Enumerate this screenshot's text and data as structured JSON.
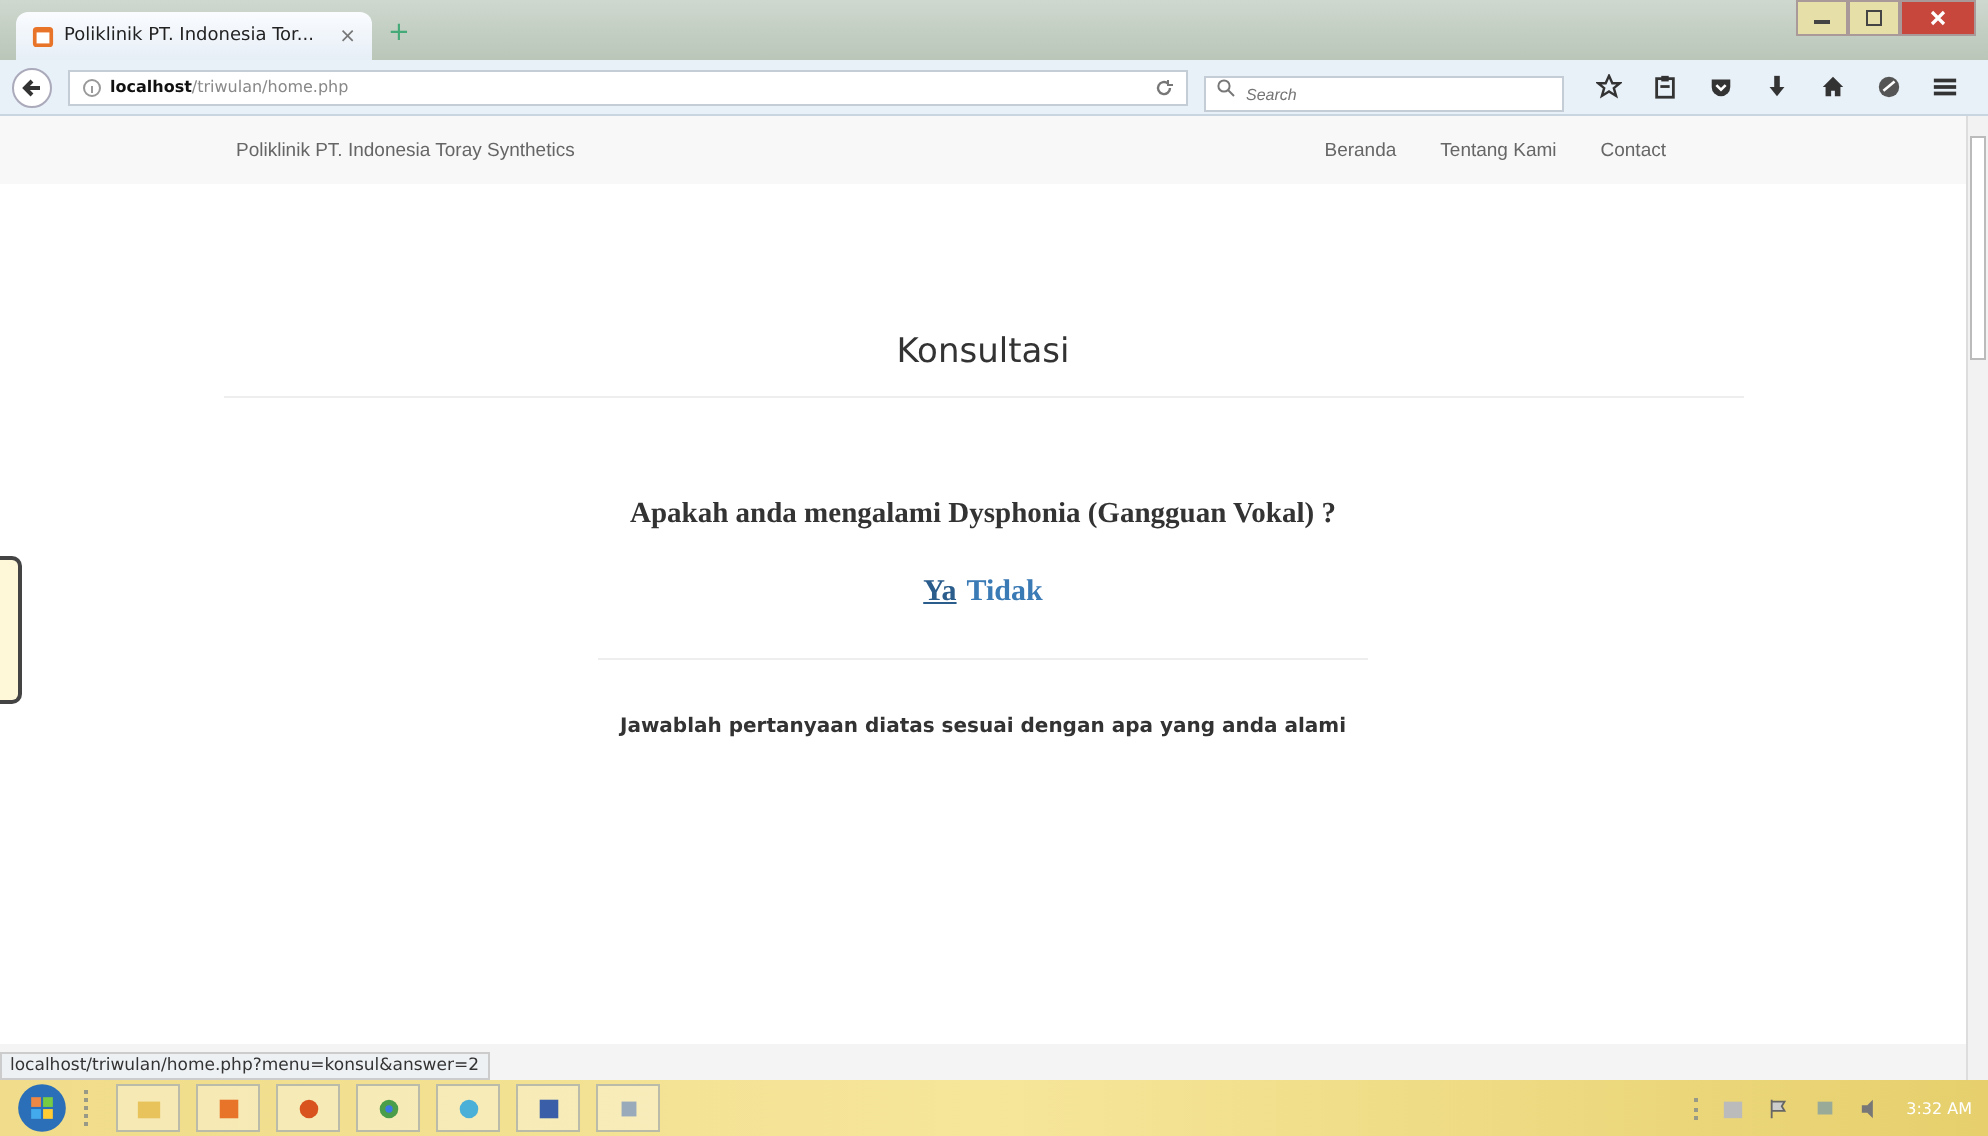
{
  "browser": {
    "tab_title": "Poliklinik PT. Indonesia Tor...",
    "tab_close": "×",
    "new_tab": "+",
    "url_host": "localhost",
    "url_path": "/triwulan/home.php",
    "search_placeholder": "Search"
  },
  "navbar": {
    "brand": "Poliklinik PT. Indonesia Toray Synthetics",
    "links": [
      {
        "label": "Beranda"
      },
      {
        "label": "Tentang Kami"
      },
      {
        "label": "Contact"
      }
    ]
  },
  "page": {
    "title": "Konsultasi",
    "question": "Apakah anda mengalami Dysphonia (Gangguan Vokal) ?",
    "answers": [
      {
        "label": "Ya",
        "hovered": true
      },
      {
        "label": "Tidak",
        "hovered": false
      }
    ],
    "note": "Jawablah pertanyaan diatas sesuai dengan apa yang anda alami"
  },
  "status_url": "localhost/triwulan/home.php?menu=konsul&answer=2",
  "taskbar": {
    "clock": "3:32 AM"
  }
}
